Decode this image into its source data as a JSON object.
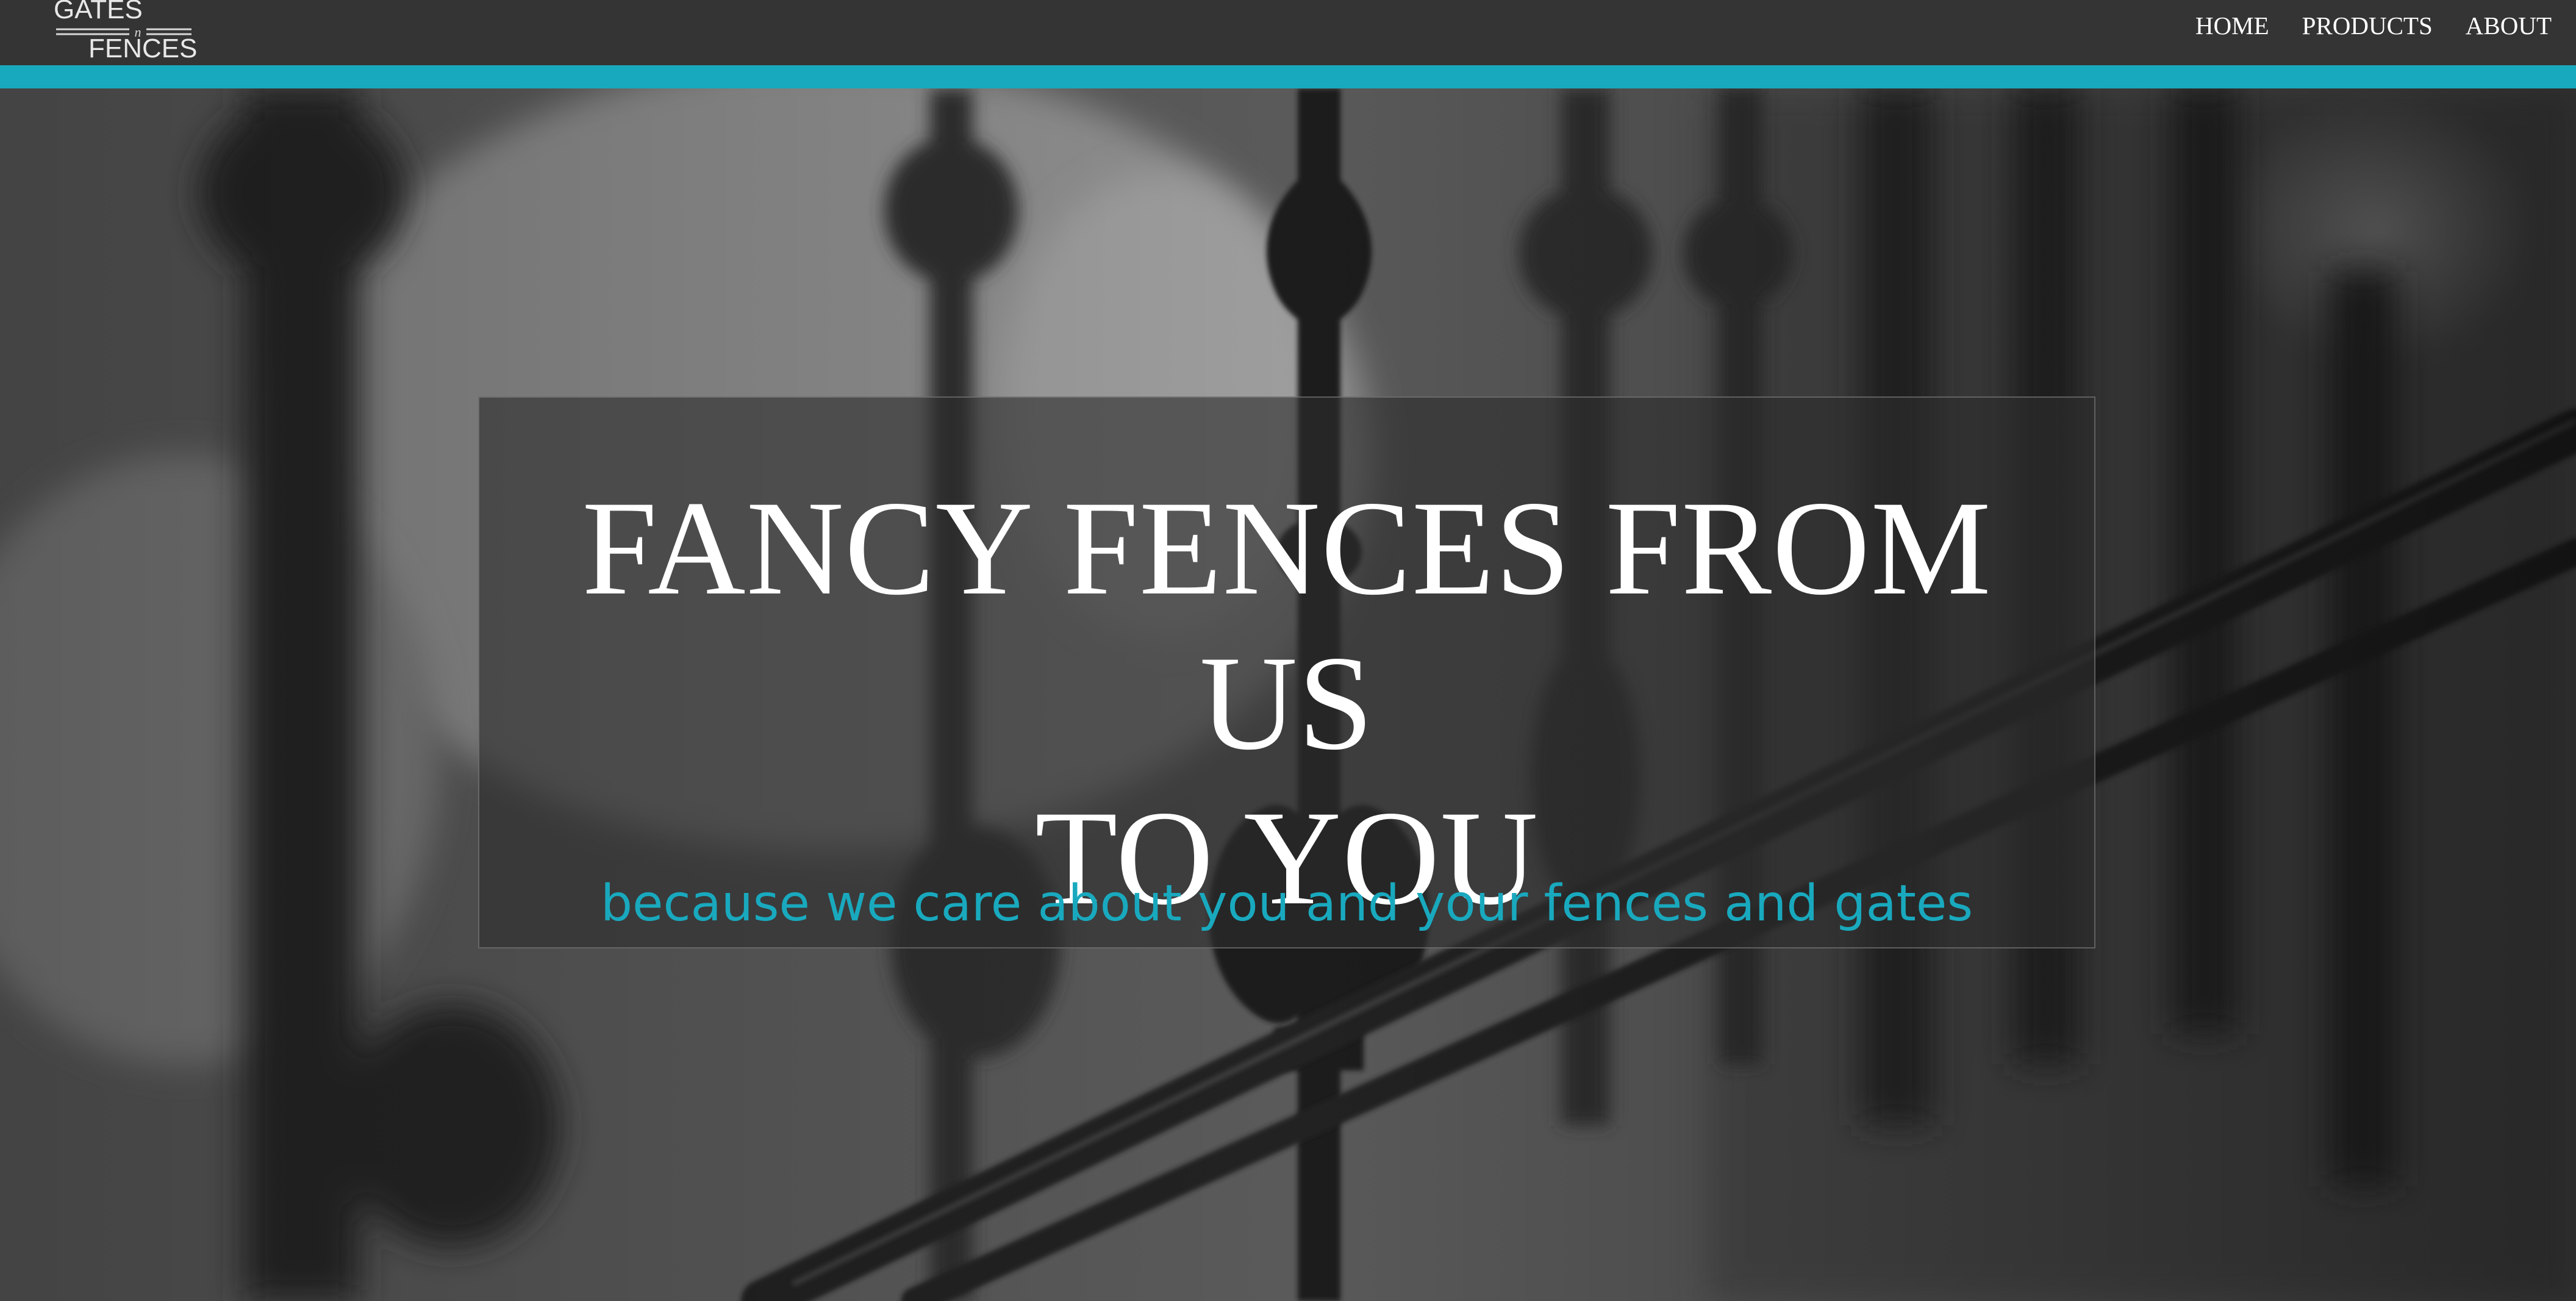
{
  "logo": {
    "line1": "GATES",
    "connector": "n",
    "line2": "FENCES"
  },
  "nav": {
    "items": [
      {
        "label": "HOME"
      },
      {
        "label": "PRODUCTS"
      },
      {
        "label": "ABOUT"
      }
    ]
  },
  "hero": {
    "title_line1": "FANCY FENCES FROM US",
    "title_line2": "TO YOU",
    "subtitle": "because we care about you and your fences and gates",
    "background": "blurred black-and-white wrought iron fence photo"
  },
  "colors": {
    "navbar": "#343434",
    "accent": "#19a9be",
    "title": "#ffffff",
    "subtitle": "#19a9be"
  }
}
